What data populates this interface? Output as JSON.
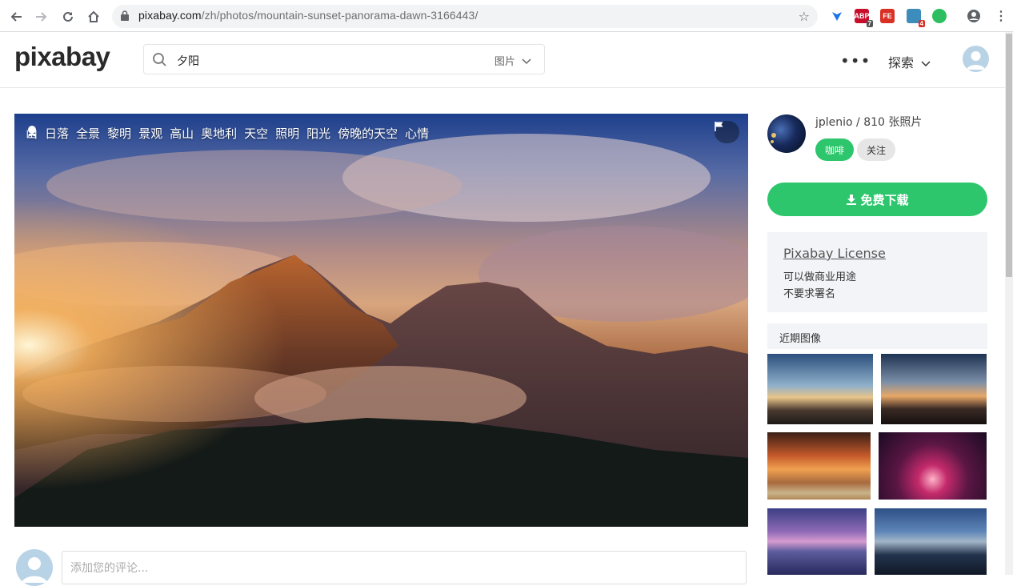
{
  "browser": {
    "url_host": "pixabay.com",
    "url_path": "/zh/photos/mountain-sunset-panorama-dawn-3166443/",
    "extensions": [
      {
        "name": "adblock-icon",
        "label": "ABP",
        "badge": "7",
        "color": "#c70d2c"
      },
      {
        "name": "fe-icon",
        "label": "FE",
        "badge": "",
        "color": "#d93025"
      },
      {
        "name": "puzzle-icon",
        "label": "",
        "badge": "4",
        "color": "#3c8dbc"
      },
      {
        "name": "evernote-icon",
        "label": "",
        "badge": "",
        "color": "#2dbe60"
      }
    ]
  },
  "header": {
    "logo": "pixabay",
    "search_query": "夕阳",
    "search_type": "图片",
    "more": "•••",
    "explore": "探索"
  },
  "photo": {
    "tags": [
      "山",
      "日落",
      "全景",
      "黎明",
      "景观",
      "高山",
      "奥地利",
      "天空",
      "照明",
      "阳光",
      "傍晚的天空",
      "心情"
    ]
  },
  "comment": {
    "placeholder": "添加您的评论..."
  },
  "sidebar": {
    "author": "jplenio / 810 张照片",
    "coffee_label": "咖啡",
    "follow_label": "关注",
    "download_label": "免费下载",
    "license_title": "Pixabay License",
    "license_line1": "可以做商业用途",
    "license_line2": "不要求署名",
    "recent_title": "近期图像"
  },
  "colors": {
    "accent_green": "#2ec66d",
    "panel_bg": "#f3f4f8"
  }
}
